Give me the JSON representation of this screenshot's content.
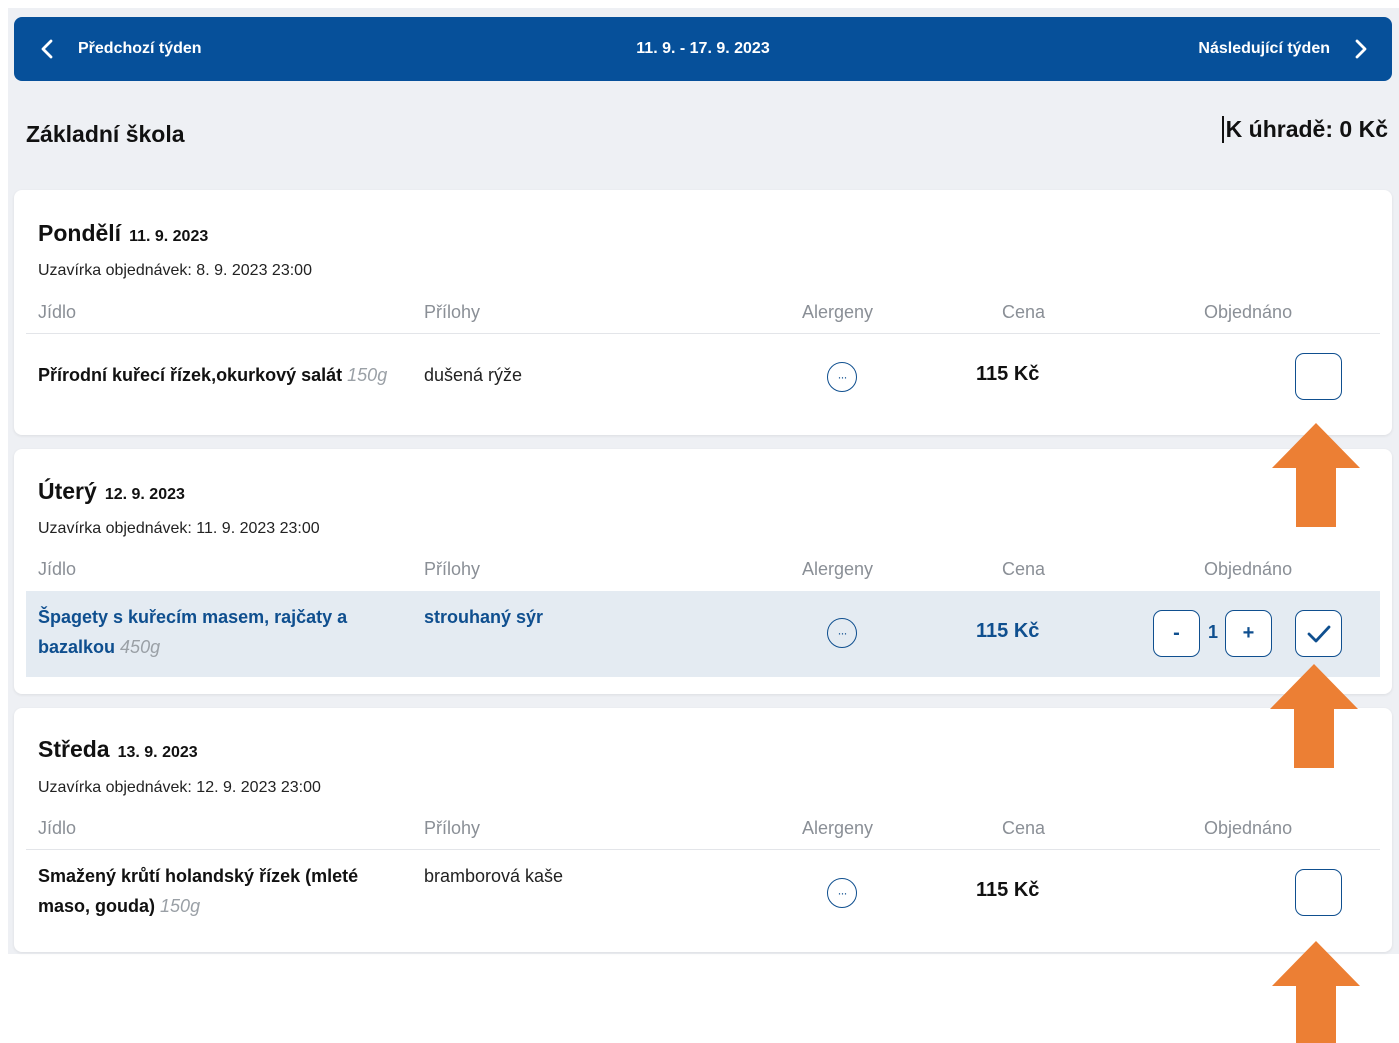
{
  "nav": {
    "prev_label": "Předchozí týden",
    "next_label": "Následující týden",
    "week_range": "11. 9. - 17. 9. 2023"
  },
  "header": {
    "school": "Základní škola",
    "due": "K úhradě: 0 Kč"
  },
  "columns": {
    "meal": "Jídlo",
    "sides": "Přílohy",
    "allergens": "Alergeny",
    "price": "Cena",
    "ordered": "Objednáno"
  },
  "days": [
    {
      "name": "Pondělí",
      "date": "11. 9. 2023",
      "deadline": "Uzavírka objednávek: 8. 9. 2023 23:00",
      "meal_name": "Přírodní kuřecí řízek,okurkový salát",
      "weight": "150g",
      "side": "dušená rýže",
      "price": "115 Kč",
      "ordered": false
    },
    {
      "name": "Úterý",
      "date": "12. 9. 2023",
      "deadline": "Uzavírka objednávek: 11. 9. 2023 23:00",
      "meal_name_line1": "Špagety s kuřecím masem, rajčaty a",
      "meal_name_line2": "bazalkou",
      "weight": "450g",
      "side": "strouhaný sýr",
      "price": "115 Kč",
      "ordered": true,
      "quantity": "1",
      "minus_label": "-",
      "plus_label": "+"
    },
    {
      "name": "Středa",
      "date": "13. 9. 2023",
      "deadline": "Uzavírka objednávek: 12. 9. 2023 23:00",
      "meal_name_line1": "Smažený krůtí holandský řízek (mleté",
      "meal_name_line2": "maso, gouda)",
      "weight": "150g",
      "side": "bramborová kaše",
      "price": "115 Kč",
      "ordered": false
    }
  ],
  "icons": {
    "allergen": "ellipsis-circle-icon",
    "prev": "chevron-left-icon",
    "next": "chevron-right-icon",
    "check": "checkmark-icon",
    "annotation": "up-arrow-icon"
  },
  "colors": {
    "brand": "#06509a",
    "accent_text": "#0f4f8f",
    "selected_row": "#e4ebf2",
    "annotation_arrow": "#ec7f34"
  }
}
